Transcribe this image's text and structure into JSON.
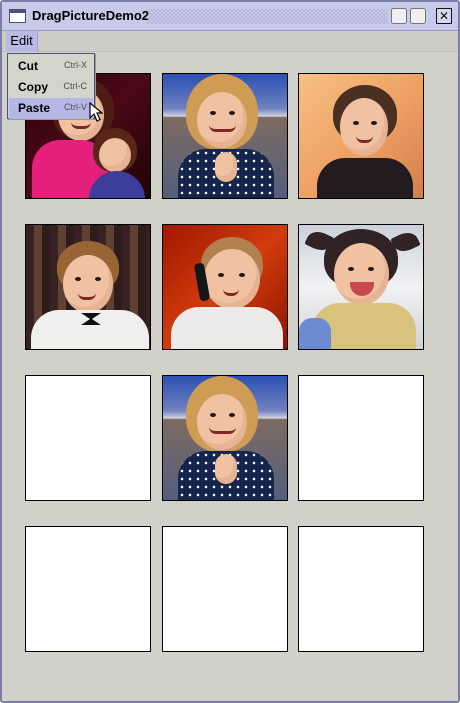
{
  "window": {
    "title": "DragPictureDemo2"
  },
  "menubar": {
    "edit_label": "Edit"
  },
  "edit_menu": {
    "items": [
      {
        "label": "Cut",
        "shortcut": "Ctrl-X"
      },
      {
        "label": "Copy",
        "shortcut": "Ctrl-C"
      },
      {
        "label": "Paste",
        "shortcut": "Ctrl-V"
      }
    ],
    "highlighted_item": "Paste"
  },
  "picture_grid": {
    "rows": 4,
    "columns": 3,
    "tiles": [
      {
        "state": "photo",
        "icon": "two-children-with-doll-photo"
      },
      {
        "state": "photo",
        "icon": "smiling-girl-photo"
      },
      {
        "state": "photo",
        "icon": "girl-with-dark-hair-photo"
      },
      {
        "state": "photo",
        "icon": "boy-in-white-suit-photo"
      },
      {
        "state": "photo",
        "icon": "toddler-with-phone-photo"
      },
      {
        "state": "photo",
        "icon": "laughing-baby-photo"
      },
      {
        "state": "empty",
        "icon": "blank-image-placeholder"
      },
      {
        "state": "photo",
        "icon": "smiling-girl-photo"
      },
      {
        "state": "empty",
        "icon": "blank-image-placeholder"
      },
      {
        "state": "empty",
        "icon": "blank-image-placeholder"
      },
      {
        "state": "empty",
        "icon": "blank-image-placeholder"
      },
      {
        "state": "empty",
        "icon": "blank-image-placeholder"
      }
    ]
  },
  "icons": {
    "window_icon": "window-icon",
    "minimize": "minimize-icon",
    "maximize": "maximize-icon",
    "close": "close-icon",
    "cursor": "mouse-pointer-icon"
  },
  "colors": {
    "titlebar": "#c9c9ea",
    "window_border": "#7c7ca8",
    "menu_highlight": "#b5b7e6",
    "workspace": "#d1d0c9"
  }
}
